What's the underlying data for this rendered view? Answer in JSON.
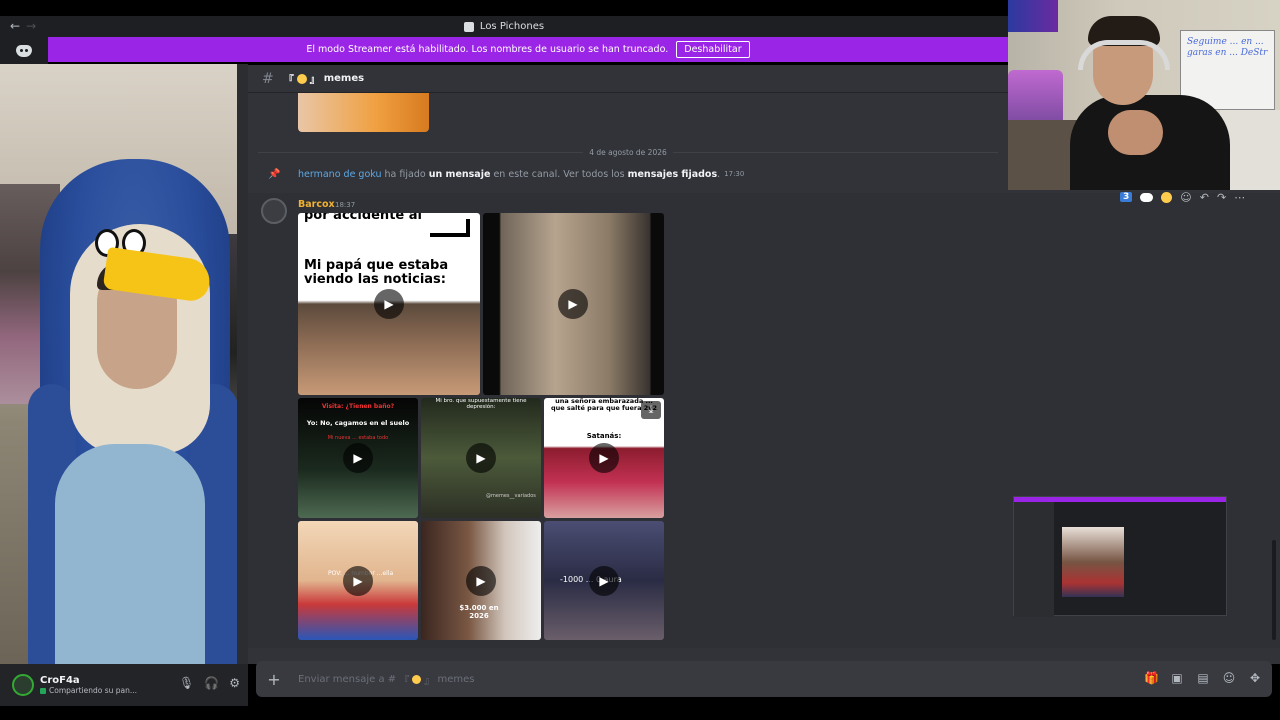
{
  "window": {
    "title": "Los Pichones",
    "back": "←",
    "forward": "→"
  },
  "banner": {
    "text": "El modo Streamer está habilitado. Los nombres de usuario se han truncado.",
    "button": "Deshabilitar",
    "color": "#9b25e6"
  },
  "channel": {
    "hash": "#",
    "prefix": "『",
    "suffix": "』",
    "name": "memes"
  },
  "divider": {
    "date": "4 de agosto de 2026"
  },
  "pin_notice": {
    "user": "hermano de goku",
    "text1": " ha fijado ",
    "link1": "un mensaje",
    "text2": " en este canal. Ver todos los ",
    "link2": "mensajes fijados",
    "text3": ".",
    "time": "17:30"
  },
  "message": {
    "author": "Barcox",
    "author_color": "#f0b232",
    "time": "18:37",
    "media": [
      {
        "caption_top": "por accidente al",
        "caption": "Mi papá que estaba viendo las noticias:"
      },
      {
        "caption": ""
      },
      {
        "caption_red": "Visita: ¿Tienen baño?",
        "caption": "Yo: No, cagamos en el suelo",
        "caption_small": "Mi nueva ... estaba todo"
      },
      {
        "caption": "Mi bro. que supuestamente tiene depresión:",
        "watermark": "@memes__variados"
      },
      {
        "caption": "una señora embarazada ... que salté para que fuera 2v2",
        "caption2": "Satanás:"
      },
      {
        "caption": "POV: ... number ...ella"
      },
      {
        "caption": "$3.000 en 2026"
      },
      {
        "caption": "-1000 ... 0 aura"
      }
    ]
  },
  "reactions": {
    "count": "3"
  },
  "input": {
    "placeholder_prefix": "Enviar mensaje a #",
    "channel_prefix": "『",
    "channel_suffix": "』",
    "channel_name": "memes"
  },
  "user_panel": {
    "name": "CroF4a",
    "status": "Compartiendo su pan..."
  },
  "whiteboard": {
    "text": "Seguime ... en ... garas en ... DeStr"
  },
  "icons": {
    "plus": "plus-icon",
    "gift": "gift-icon",
    "gif": "gif-icon",
    "sticker": "sticker-icon",
    "emoji": "emoji-icon",
    "apps": "apps-icon",
    "mic": "microphone-icon",
    "headset": "headphones-icon",
    "settings": "gear-icon"
  }
}
